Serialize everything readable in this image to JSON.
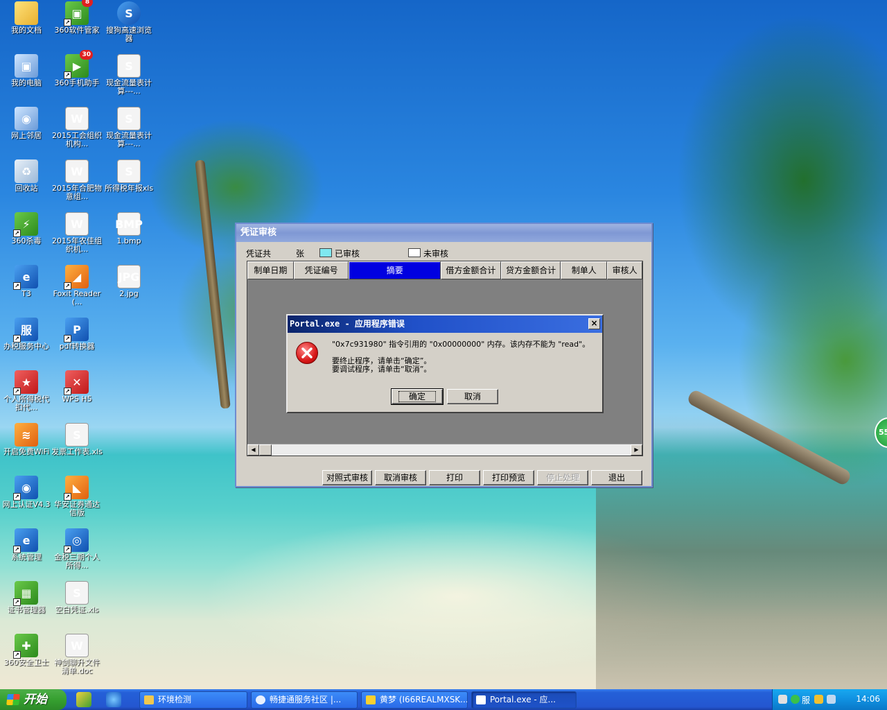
{
  "desktop": {
    "icons": [
      {
        "label": "我的文档"
      },
      {
        "label": "360软件管家",
        "badge": "8"
      },
      {
        "label": "搜狗高速浏览器"
      },
      {
        "label": "我的电脑"
      },
      {
        "label": "360手机助手",
        "badge": "30"
      },
      {
        "label": "现金流量表计算---..."
      },
      {
        "label": "网上邻居"
      },
      {
        "label": "2015工会组织机构..."
      },
      {
        "label": "现金流量表计算---..."
      },
      {
        "label": "回收站"
      },
      {
        "label": "2015年合肥物意组..."
      },
      {
        "label": "所得税年报xls"
      },
      {
        "label": "360杀毒"
      },
      {
        "label": "2015年农佳组织机..."
      },
      {
        "label": "1.bmp"
      },
      {
        "label": "T3"
      },
      {
        "label": "Foxit Reader(..."
      },
      {
        "label": "2.jpg"
      },
      {
        "label": "办税服务中心"
      },
      {
        "label": "pdf转换器"
      },
      {
        "label": "个人所得税代扣代..."
      },
      {
        "label": "WPS H5"
      },
      {
        "label": "开启免费WiFi"
      },
      {
        "label": "发票工作表.xls"
      },
      {
        "label": "网上认证V4.3"
      },
      {
        "label": "华安证券通达信版"
      },
      {
        "label": "系统管理"
      },
      {
        "label": "金税三期个人所得..."
      },
      {
        "label": "证书管理器"
      },
      {
        "label": "空白凭证.xls"
      },
      {
        "label": "360安全卫士"
      },
      {
        "label": "神剑聊升文件清单.doc"
      }
    ],
    "icon_glyphs": {
      "s": "S",
      "w": "W",
      "bmp": "BMP",
      "jpg": "JPG",
      "serve": "服"
    }
  },
  "voucher_window": {
    "title": "凭证审核",
    "info": {
      "count_prefix": "凭证共",
      "count_suffix": "张",
      "audited": "已审核",
      "unaudited": "未审核"
    },
    "legend_colors": {
      "audited": "#7fe8f0",
      "unaudited": "#ffffff"
    },
    "columns": [
      "制单日期",
      "凭证编号",
      "摘要",
      "借方金额合计",
      "贷方金额合计",
      "制单人",
      "审核人"
    ],
    "selected_column": "摘要",
    "buttons": [
      "对照式审核",
      "取消审核",
      "打印",
      "打印预览",
      "停止处理",
      "退出"
    ],
    "disabled_button": "停止处理"
  },
  "error_dialog": {
    "title": "Portal.exe - 应用程序错误",
    "close": "×",
    "message_line1": "\"0x7c931980\" 指令引用的 \"0x00000000\" 内存。该内存不能为 \"read\"。",
    "message_line2": "要终止程序，请单击“确定”。",
    "message_line3": "要调试程序，请单击“取消”。",
    "ok": "确定",
    "cancel": "取消"
  },
  "taskbar": {
    "start": "开始",
    "tasks": [
      {
        "label": "环境检测"
      },
      {
        "label": "畅捷通服务社区 |..."
      },
      {
        "label": "黄梦 (I66REALMXSK..."
      },
      {
        "label": "Portal.exe - 应..."
      }
    ],
    "tray_text": "服",
    "clock": "14:06"
  },
  "floating_ball": "55"
}
